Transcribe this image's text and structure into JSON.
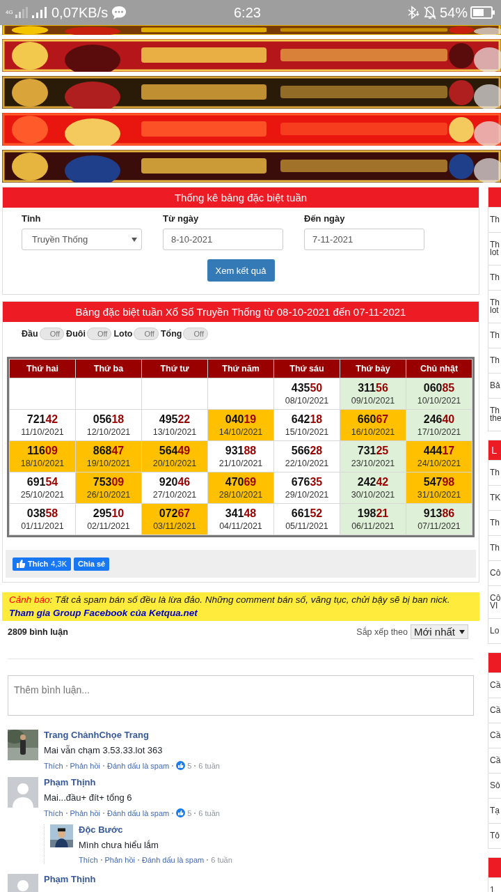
{
  "status_bar": {
    "network": "4G",
    "speed": "0,07KB/s",
    "time": "6:23",
    "battery": "54%"
  },
  "form": {
    "title": "Thống kê bảng đặc biệt tuần",
    "fields": [
      {
        "kind": "select",
        "label": "Tỉnh",
        "value": "Truyền Thống"
      },
      {
        "kind": "date",
        "label": "Từ ngày",
        "value": "8-10-2021"
      },
      {
        "kind": "date",
        "label": "Đến ngày",
        "value": "7-11-2021"
      }
    ],
    "button": "Xem kết quả"
  },
  "results": {
    "title": "Bảng đặc biệt tuần Xổ Số Truyền Thống từ 08-10-2021 đến 07-11-2021",
    "toggles": [
      {
        "label": "Đầu",
        "state": "Off",
        "on": false
      },
      {
        "label": "Đuôi",
        "state": "Off",
        "on": false
      },
      {
        "label": "Loto",
        "state": "Off",
        "on": false
      },
      {
        "label": "Tổng",
        "state": "Off",
        "on": false
      }
    ],
    "columns": [
      "Thứ hai",
      "Thứ ba",
      "Thứ tư",
      "Thứ năm",
      "Thứ sáu",
      "Thứ bảy",
      "Chủ nhật"
    ],
    "rows": [
      [
        {},
        {},
        {},
        {},
        {
          "head": "435",
          "tail": "50",
          "date": "08/10/2021"
        },
        {
          "head": "311",
          "tail": "56",
          "date": "09/10/2021",
          "color": "#dff0d8"
        },
        {
          "head": "060",
          "tail": "85",
          "date": "10/10/2021",
          "color": "#dff0d8"
        }
      ],
      [
        {
          "head": "721",
          "tail": "42",
          "date": "11/10/2021"
        },
        {
          "head": "056",
          "tail": "18",
          "date": "12/10/2021"
        },
        {
          "head": "495",
          "tail": "22",
          "date": "13/10/2021"
        },
        {
          "head": "040",
          "tail": "19",
          "date": "14/10/2021",
          "color": "#ffc000"
        },
        {
          "head": "642",
          "tail": "18",
          "date": "15/10/2021"
        },
        {
          "head": "660",
          "tail": "67",
          "date": "16/10/2021",
          "color": "#ffc000"
        },
        {
          "head": "246",
          "tail": "40",
          "date": "17/10/2021",
          "color": "#dff0d8"
        }
      ],
      [
        {
          "head": "116",
          "tail": "09",
          "date": "18/10/2021",
          "color": "#ffc000"
        },
        {
          "head": "868",
          "tail": "47",
          "date": "19/10/2021",
          "color": "#ffc000"
        },
        {
          "head": "564",
          "tail": "49",
          "date": "20/10/2021",
          "color": "#ffc000"
        },
        {
          "head": "931",
          "tail": "88",
          "date": "21/10/2021"
        },
        {
          "head": "566",
          "tail": "28",
          "date": "22/10/2021"
        },
        {
          "head": "731",
          "tail": "25",
          "date": "23/10/2021",
          "color": "#dff0d8"
        },
        {
          "head": "444",
          "tail": "17",
          "date": "24/10/2021",
          "color": "#ffc000"
        }
      ],
      [
        {
          "head": "691",
          "tail": "54",
          "date": "25/10/2021"
        },
        {
          "head": "753",
          "tail": "09",
          "date": "26/10/2021",
          "color": "#ffc000"
        },
        {
          "head": "920",
          "tail": "46",
          "date": "27/10/2021"
        },
        {
          "head": "470",
          "tail": "69",
          "date": "28/10/2021",
          "color": "#ffc000"
        },
        {
          "head": "676",
          "tail": "35",
          "date": "29/10/2021"
        },
        {
          "head": "242",
          "tail": "42",
          "date": "30/10/2021",
          "color": "#dff0d8"
        },
        {
          "head": "547",
          "tail": "98",
          "date": "31/10/2021",
          "color": "#ffc000"
        }
      ],
      [
        {
          "head": "038",
          "tail": "58",
          "date": "01/11/2021"
        },
        {
          "head": "295",
          "tail": "10",
          "date": "02/11/2021"
        },
        {
          "head": "072",
          "tail": "67",
          "date": "03/11/2021",
          "color": "#ffc000"
        },
        {
          "head": "341",
          "tail": "48",
          "date": "04/11/2021"
        },
        {
          "head": "661",
          "tail": "52",
          "date": "05/11/2021"
        },
        {
          "head": "198",
          "tail": "21",
          "date": "06/11/2021",
          "color": "#dff0d8"
        },
        {
          "head": "913",
          "tail": "86",
          "date": "07/11/2021",
          "color": "#dff0d8"
        }
      ]
    ],
    "like_button": {
      "label": "Thích",
      "count": "4,3K"
    },
    "share_button": "Chia sẻ"
  },
  "warning": {
    "label": "Cảnh báo",
    "text": ": Tất cả spam bán số đều là lừa đảo. Những comment bán số, văng tục, chửi bậy sẽ bị ban nick.",
    "link": "Tham gia Group Facebook của Ketqua.net"
  },
  "comments": {
    "count": "2809 bình luận",
    "sort_label": "Sắp xếp theo",
    "sort_value": "Mới nhất",
    "placeholder": "Thêm bình luận...",
    "items": [
      {
        "name": "Trang ChảnhChọe Trang",
        "text": "Mai vẫn chạm 3.53.33.lot 363",
        "actions": [
          "Thích",
          "Phản hồi",
          "Đánh dấu là spam"
        ],
        "likes": "5",
        "time": "6 tuần"
      },
      {
        "name": "Phạm Thịnh",
        "kind": "default",
        "text": "Mai...đầu+ đít+ tổng 6",
        "actions": [
          "Thích",
          "Phản hồi",
          "Đánh dấu là spam"
        ],
        "likes": "5",
        "time": "6 tuần",
        "replies": [
          {
            "name": "Độc Bước",
            "text": "Mình chưa hiểu lắm",
            "actions": [
              "Thích",
              "Phản hồi",
              "Đánh dấu là spam"
            ],
            "time": "6 tuần"
          }
        ]
      },
      {
        "name": "Phạm Thịnh",
        "kind": "default"
      }
    ]
  },
  "sidebar": [
    {
      "items": [
        "Th",
        "Th lot",
        "Th",
        "Th lot",
        "Th",
        "Th",
        "Bả",
        "Th the"
      ]
    },
    {
      "title": "L",
      "items": [
        "Th",
        "TK",
        "Th",
        "Th",
        "Cô",
        "Cô VI",
        "Lo"
      ]
    },
    {
      "items": [
        "Cầ",
        "Cầ",
        "Cầ",
        "Cầ",
        "Sô",
        "Tạ",
        "Tô"
      ]
    },
    {
      "items": [
        "1"
      ]
    }
  ]
}
